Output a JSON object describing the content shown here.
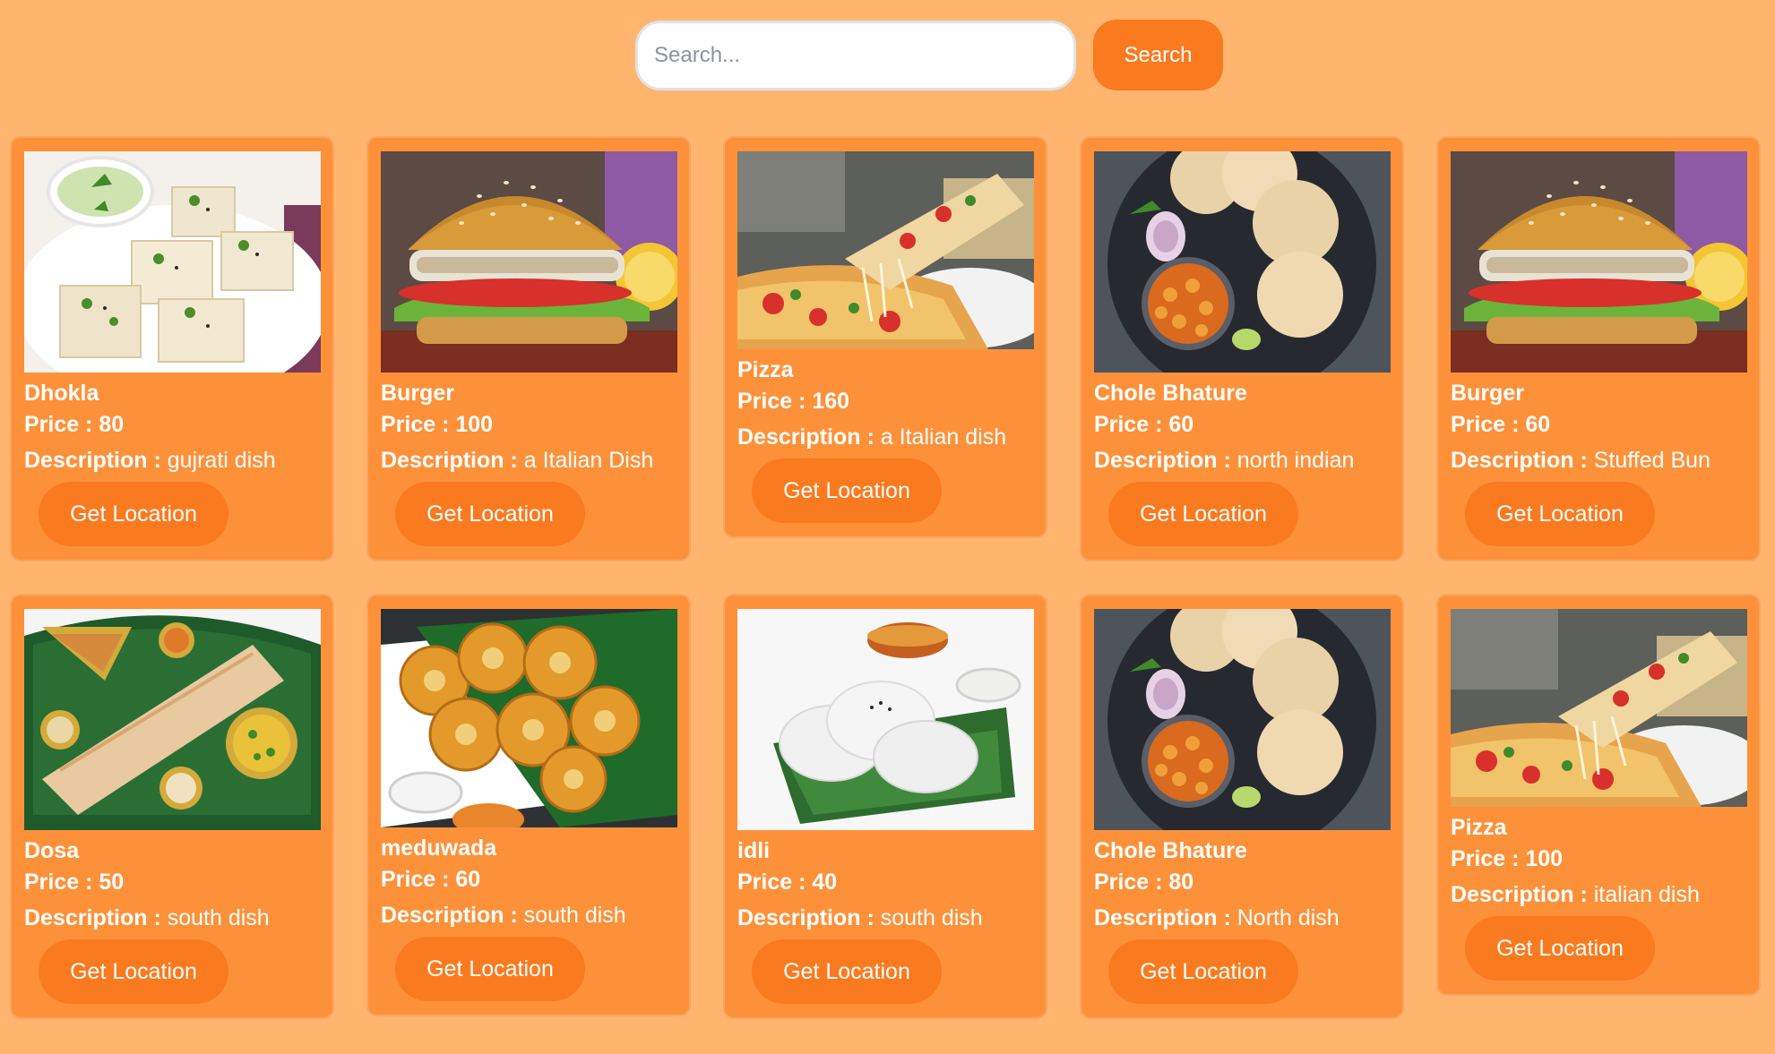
{
  "search": {
    "placeholder": "Search...",
    "button_label": "Search"
  },
  "labels": {
    "price": "Price : ",
    "description": "Description : ",
    "location_button": "Get Location"
  },
  "dishes": [
    {
      "name": "Dhokla",
      "price": "80",
      "description": "gujrati dish",
      "image": "dhokla"
    },
    {
      "name": "Burger",
      "price": "100",
      "description": "a Italian Dish",
      "image": "burger"
    },
    {
      "name": "Pizza",
      "price": "160",
      "description": "a Italian dish",
      "image": "pizza"
    },
    {
      "name": "Chole Bhature",
      "price": "60",
      "description": "north indian",
      "image": "chole-bhature"
    },
    {
      "name": "Burger",
      "price": "60",
      "description": "Stuffed Bun",
      "image": "burger"
    },
    {
      "name": "Dosa",
      "price": "50",
      "description": "south dish",
      "image": "dosa"
    },
    {
      "name": "meduwada",
      "price": "60",
      "description": "south dish",
      "image": "meduwada"
    },
    {
      "name": "idli",
      "price": "40",
      "description": "south dish",
      "image": "idli"
    },
    {
      "name": "Chole Bhature",
      "price": "80",
      "description": "North dish",
      "image": "chole-bhature"
    },
    {
      "name": "Pizza",
      "price": "100",
      "description": "italian dish",
      "image": "pizza"
    }
  ]
}
